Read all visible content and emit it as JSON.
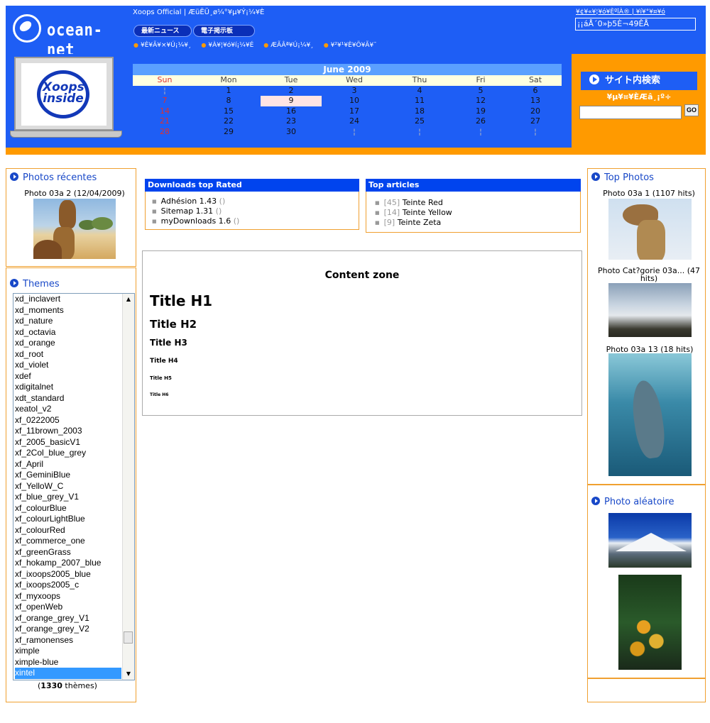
{
  "header": {
    "logo_text": "ocean-net",
    "site_title": "Xoops Official | ÆüËÜ¸ø¼°¥µ¥Ý¡¼¥È",
    "pills": [
      "最新ニュース",
      "電子掲示板"
    ],
    "menu_links": [
      "¥È¥Ã¥×¥Ú¡¼¥¸",
      "¥À¥¦¥ó¥í¡¼¥É",
      "ÆÃÂª¥Ú¡¼¥¸",
      "¥²¥¹¥È¥Ö¥Ã¥¯"
    ],
    "top_right_links": "¥¢¥«¥¦¥ó¥ÈºîÀ® | ¥í¥°¥¤¥ó",
    "top_right_box": "¡¡áÅ´0»þ5È¬49ÊÅ"
  },
  "laptop_logo": "Xoops inside",
  "calendar": {
    "title": "June 2009",
    "days": [
      "Sun",
      "Mon",
      "Tue",
      "Wed",
      "Thu",
      "Fri",
      "Sat"
    ],
    "weeks": [
      [
        "¦",
        "1",
        "2",
        "3",
        "4",
        "5",
        "6"
      ],
      [
        "7",
        "8",
        "9",
        "10",
        "11",
        "12",
        "13"
      ],
      [
        "14",
        "15",
        "16",
        "17",
        "18",
        "19",
        "20"
      ],
      [
        "21",
        "22",
        "23",
        "24",
        "25",
        "26",
        "27"
      ],
      [
        "28",
        "29",
        "30",
        "¦",
        "¦",
        "¦",
        "¦"
      ]
    ],
    "today": "9"
  },
  "search": {
    "title": "サイト内検索",
    "subtitle": "¥µ¥¤¥ÈÆâ¸¡º÷",
    "go_label": "GO"
  },
  "left": {
    "recent_title": "Photos récentes",
    "recent_caption": "Photo 03a 2 (12/04/2009)",
    "themes_title": "Themes",
    "themes": [
      "xd_inclavert",
      "xd_moments",
      "xd_nature",
      "xd_octavia",
      "xd_orange",
      "xd_root",
      "xd_violet",
      "xdef",
      "xdigitalnet",
      "xdt_standard",
      "xeatol_v2",
      "xf_0222005",
      "xf_11brown_2003",
      "xf_2005_basicV1",
      "xf_2Col_blue_grey",
      "xf_April",
      "xf_GeminiBlue",
      "xf_YelloW_C",
      "xf_blue_grey_V1",
      "xf_colourBlue",
      "xf_colourLightBlue",
      "xf_colourRed",
      "xf_commerce_one",
      "xf_greenGrass",
      "xf_hokamp_2007_blue",
      "xf_ixoops2005_blue",
      "xf_ixoops2005_c",
      "xf_myxoops",
      "xf_openWeb",
      "xf_orange_grey_V1",
      "xf_orange_grey_V2",
      "xf_ramonenses",
      "ximple",
      "ximple-blue",
      "xintel"
    ],
    "selected_theme": "xintel",
    "theme_count_open": "(",
    "theme_count": "1330",
    "theme_count_close": " thèmes)"
  },
  "center": {
    "downloads_title": "Downloads top Rated",
    "downloads": [
      {
        "name": "Adhésion 1.43",
        "extra": "()"
      },
      {
        "name": "Sitemap 1.31",
        "extra": "()"
      },
      {
        "name": "myDownloads 1.6",
        "extra": "()"
      }
    ],
    "articles_title": "Top articles",
    "articles": [
      {
        "count": "[45]",
        "name": "Teinte Red"
      },
      {
        "count": "[14]",
        "name": "Teinte Yellow"
      },
      {
        "count": "[9]",
        "name": "Teinte Zeta"
      }
    ],
    "content_zone_title": "Content zone",
    "headings": [
      "Title H1",
      "Title H2",
      "Title H3",
      "Title H4",
      "Title H5",
      "Title H6"
    ]
  },
  "right": {
    "top_photos_title": "Top Photos",
    "top_photos": [
      "Photo 03a 1 (1107 hits)",
      "Photo Cat?gorie 03a... (47 hits)",
      "Photo 03a 13 (18 hits)"
    ],
    "random_title": "Photo aléatoire"
  },
  "colors": {
    "header_blue": "#1e5ef5",
    "accent_orange": "#ff9a00",
    "block_title_blue": "#0044ee",
    "link_blue": "#1848c8"
  }
}
